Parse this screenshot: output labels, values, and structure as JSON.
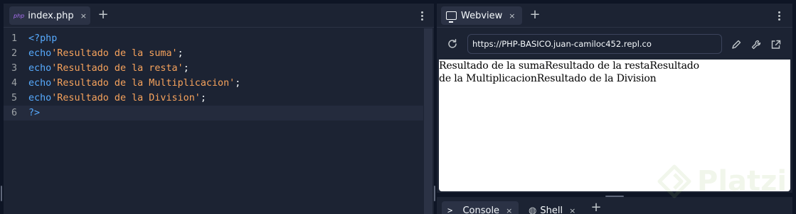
{
  "editor": {
    "tab": {
      "badge": "php",
      "label": "index.php",
      "close": "×"
    },
    "add_tab": "+",
    "lines": [
      {
        "number": "1",
        "tokens": [
          {
            "t": "<?php",
            "c": "tag"
          }
        ]
      },
      {
        "number": "2",
        "tokens": [
          {
            "t": "echo",
            "c": "kw"
          },
          {
            "t": "'Resultado de la suma'",
            "c": "str"
          },
          {
            "t": ";",
            "c": "punc"
          }
        ]
      },
      {
        "number": "3",
        "tokens": [
          {
            "t": "echo",
            "c": "kw"
          },
          {
            "t": "'Resultado de la resta'",
            "c": "str"
          },
          {
            "t": ";",
            "c": "punc"
          }
        ]
      },
      {
        "number": "4",
        "tokens": [
          {
            "t": "echo",
            "c": "kw"
          },
          {
            "t": "'Resultado de la Multiplicacion'",
            "c": "str"
          },
          {
            "t": ";",
            "c": "punc"
          }
        ]
      },
      {
        "number": "5",
        "tokens": [
          {
            "t": "echo",
            "c": "kw"
          },
          {
            "t": "'Resultado de la Division'",
            "c": "str"
          },
          {
            "t": ";",
            "c": "punc"
          }
        ]
      },
      {
        "number": "6",
        "tokens": [
          {
            "t": "?>",
            "c": "tag"
          }
        ]
      }
    ],
    "current_line": 6
  },
  "webview": {
    "tab": {
      "label": "Webview",
      "close": "×",
      "icon": "monitor-icon"
    },
    "add_tab": "+",
    "url": "https://PHP-BASICO.juan-camiloc452.repl.co",
    "content": "Resultado de la sumaResultado de la restaResultado de la MultiplicacionResultado de la Division"
  },
  "console": {
    "tabs": [
      {
        "label": "Console",
        "icon": ">_",
        "close": "×",
        "active": true
      },
      {
        "label": "Shell",
        "icon": "shell-icon",
        "close": "×",
        "active": false
      }
    ],
    "add_tab": "+"
  },
  "watermark": {
    "text": "Platzi"
  },
  "colors": {
    "background": "#0e1525",
    "panel": "#1c2333",
    "tab_active": "#2b3245",
    "keyword": "#57abff",
    "string": "#f7a35c",
    "text": "#f5f9fc"
  }
}
